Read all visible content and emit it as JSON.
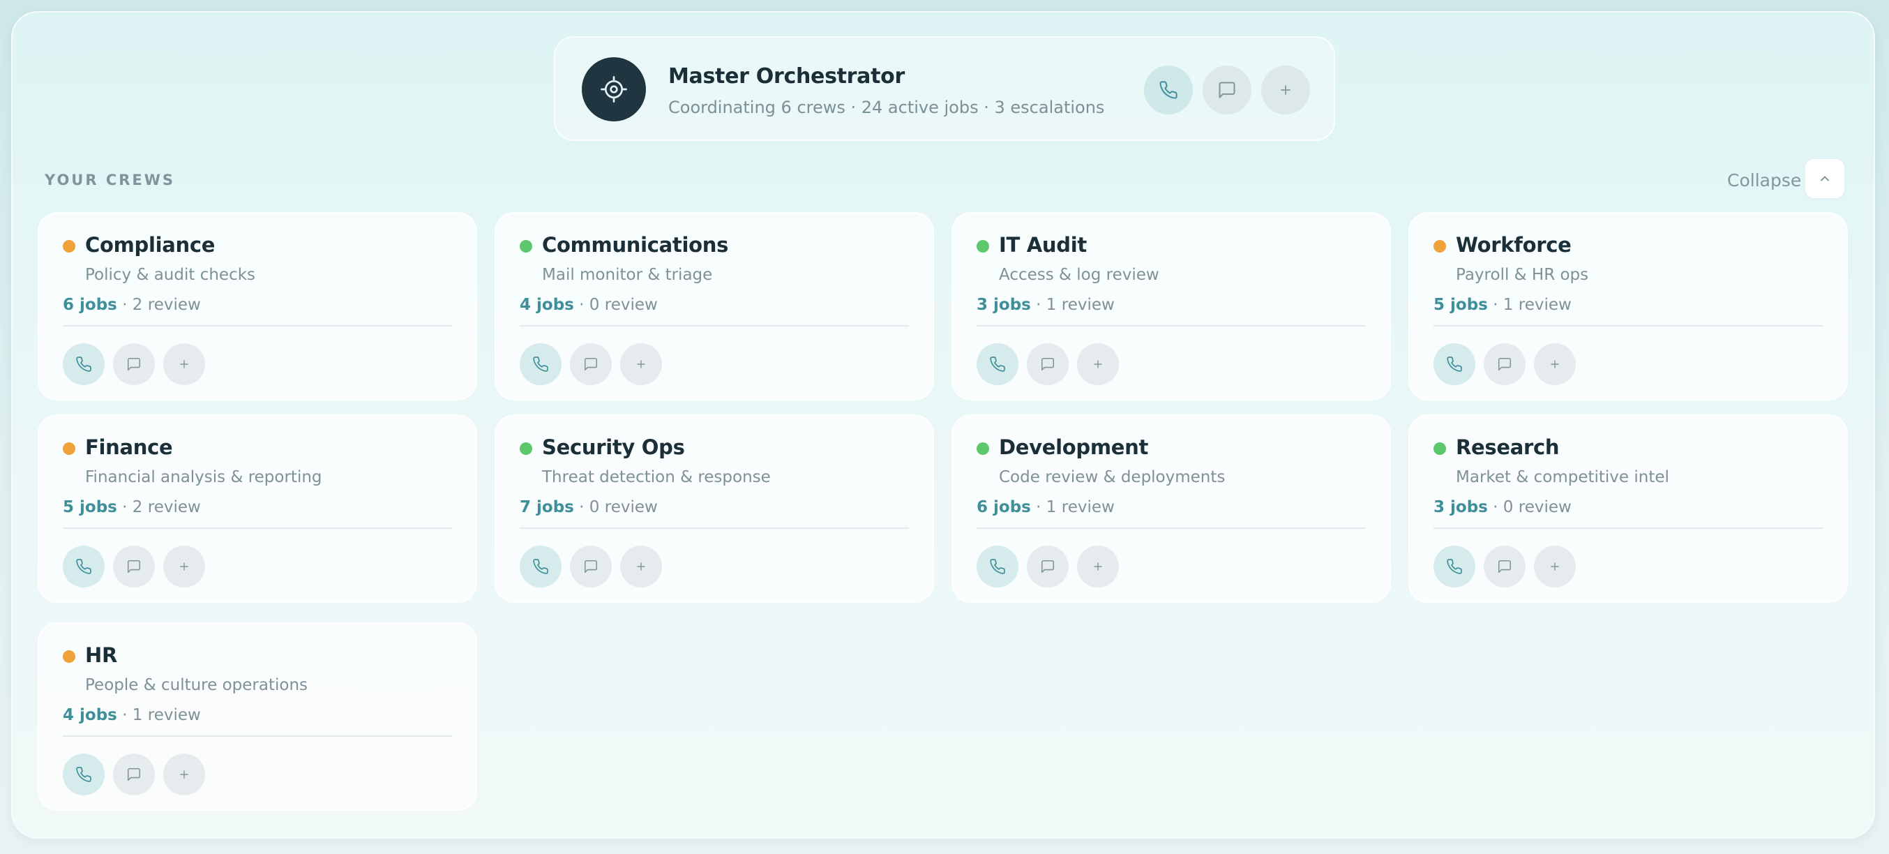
{
  "colors": {
    "accent": "#3f8f9a",
    "status_warning": "#f0a23a",
    "status_ok": "#5cc76b",
    "master_avatar_bg": "#1f3540"
  },
  "master": {
    "icon": "target-icon",
    "title": "Master Orchestrator",
    "subtitle_crews": "Coordinating 6 crews",
    "subtitle_jobs": "24 active jobs",
    "subtitle_escalations": "3 escalations",
    "separator": " · ",
    "actions": [
      "phone-icon",
      "message-icon",
      "plus-icon"
    ]
  },
  "section": {
    "title": "YOUR CREWS",
    "collapse_label": "Collapse",
    "collapse_icon": "chevron-up-icon"
  },
  "crews": [
    {
      "name": "Compliance",
      "desc": "Policy & audit checks",
      "jobs": "6 jobs",
      "review": "2 review",
      "status": "warning"
    },
    {
      "name": "Communications",
      "desc": "Mail monitor & triage",
      "jobs": "4 jobs",
      "review": "0 review",
      "status": "ok"
    },
    {
      "name": "IT Audit",
      "desc": "Access & log review",
      "jobs": "3 jobs",
      "review": "1 review",
      "status": "ok"
    },
    {
      "name": "Workforce",
      "desc": "Payroll & HR ops",
      "jobs": "5 jobs",
      "review": "1 review",
      "status": "warning"
    },
    {
      "name": "Finance",
      "desc": "Financial analysis & reporting",
      "jobs": "5 jobs",
      "review": "2 review",
      "status": "warning"
    },
    {
      "name": "Security Ops",
      "desc": "Threat detection & response",
      "jobs": "7 jobs",
      "review": "0 review",
      "status": "ok"
    },
    {
      "name": "Development",
      "desc": "Code review & deployments",
      "jobs": "6 jobs",
      "review": "1 review",
      "status": "ok"
    },
    {
      "name": "Research",
      "desc": "Market & competitive intel",
      "jobs": "3 jobs",
      "review": "0 review",
      "status": "ok"
    },
    {
      "name": "HR",
      "desc": "People & culture operations",
      "jobs": "4 jobs",
      "review": "1 review",
      "status": "warning"
    }
  ],
  "stat_separator": " · "
}
